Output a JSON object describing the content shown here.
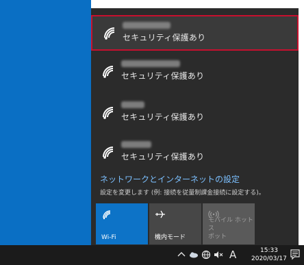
{
  "networks": [
    {
      "ssid": "",
      "security": "セキュリティ保護あり",
      "selected": true
    },
    {
      "ssid": "",
      "security": "セキュリティ保護あり",
      "selected": false
    },
    {
      "ssid": "",
      "security": "セキュリティ保護あり",
      "selected": false
    },
    {
      "ssid": "",
      "security": "セキュリティ保護あり",
      "selected": false
    }
  ],
  "settings": {
    "link": "ネットワークとインターネットの設定",
    "description": "設定を変更します (例: 接続を従量制課金接続に設定する)。"
  },
  "quick_actions": [
    {
      "label": "Wi-Fi",
      "state": "on",
      "icon": "wifi-icon"
    },
    {
      "label": "機内モード",
      "state": "off",
      "icon": "airplane-icon"
    },
    {
      "label": "モバイル ホットス\nポット",
      "state": "disabled",
      "icon": "hotspot-icon"
    }
  ],
  "taskbar": {
    "ime": "A",
    "time": "15:33",
    "date": "2020/03/17"
  },
  "colors": {
    "accent": "#0d73c7",
    "selection_border": "#c8102e",
    "link": "#7cc0ff"
  }
}
